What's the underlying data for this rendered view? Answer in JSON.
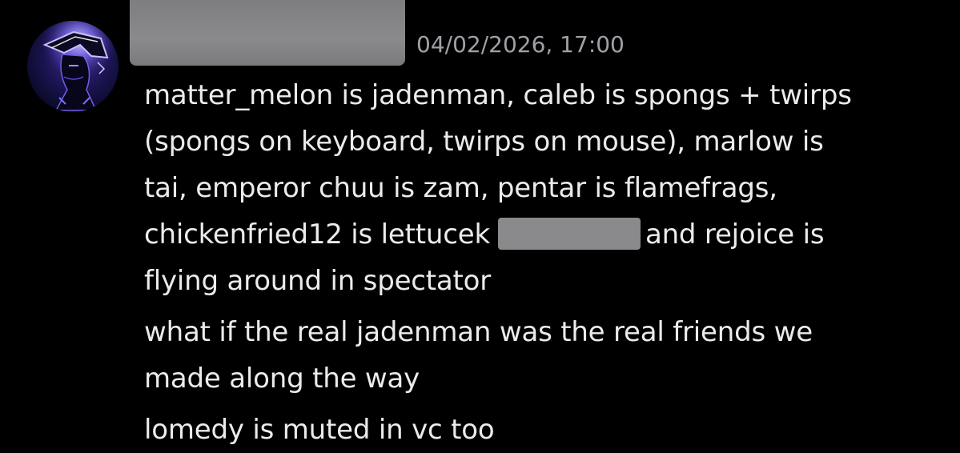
{
  "message": {
    "timestamp": "04/02/2026, 17:00",
    "avatar_icon": "hooded-figure-avatar-icon",
    "messages": [
      {
        "lines": [
          "matter_melon is jadenman, caleb is spongs + twirps",
          "(spongs on keyboard, twirps on mouse), marlow is",
          "tai, emperor chuu is zam, pentar is flamefrags,",
          {
            "before": "chickenfried12 is lettucek",
            "after": "and rejoice is"
          },
          "flying around in spectator"
        ]
      },
      {
        "lines": [
          "what if the real jadenman was the real friends we",
          "made along the way"
        ]
      },
      {
        "lines": [
          "lomedy is muted in vc too"
        ]
      }
    ]
  },
  "colors": {
    "background": "#000000",
    "text": "#ebebee",
    "timestamp": "#a0a0a6",
    "redaction": "#8a8a8d",
    "avatar_glow": "#8b7bff"
  }
}
